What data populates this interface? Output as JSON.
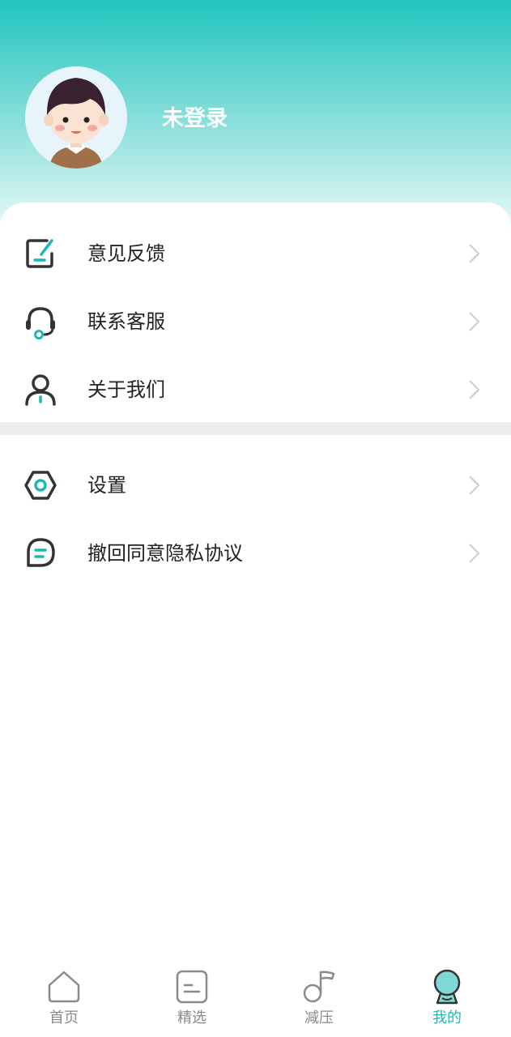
{
  "profile": {
    "username": "未登录",
    "avatar_icon": "boy-avatar-icon"
  },
  "menu_group_1": [
    {
      "label": "意见反馈",
      "icon": "feedback-edit-icon"
    },
    {
      "label": "联系客服",
      "icon": "headset-icon"
    },
    {
      "label": "关于我们",
      "icon": "user-icon"
    }
  ],
  "menu_group_2": [
    {
      "label": "设置",
      "icon": "gear-hexagon-icon"
    },
    {
      "label": "撤回同意隐私协议",
      "icon": "chat-bubble-icon"
    }
  ],
  "tabbar": [
    {
      "label": "首页",
      "icon": "home-icon",
      "active": false
    },
    {
      "label": "精选",
      "icon": "list-box-icon",
      "active": false
    },
    {
      "label": "减压",
      "icon": "music-note-icon",
      "active": false
    },
    {
      "label": "我的",
      "icon": "profile-icon",
      "active": true
    }
  ],
  "colors": {
    "accent": "#1fb8b1",
    "header_top": "#22c5be",
    "icon_dark": "#333333",
    "tab_inactive": "#8a8a8a",
    "divider": "#eeeeee"
  }
}
